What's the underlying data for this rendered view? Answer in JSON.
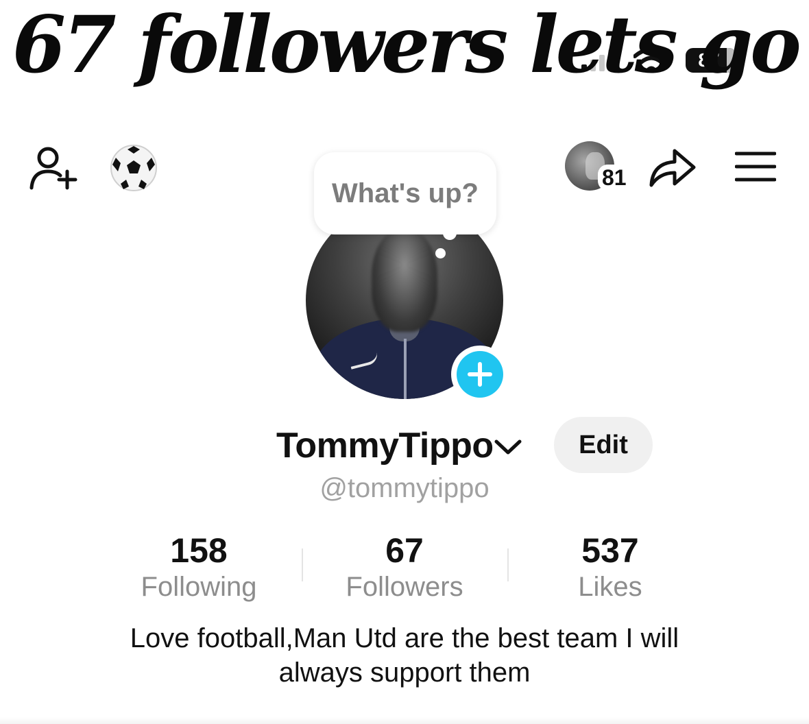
{
  "overlay_caption": "67 followers lets go",
  "status_bar": {
    "battery_level": "87",
    "signal_bars_active": 1,
    "signal_bars_total": 4
  },
  "top_nav": {
    "left_icons": [
      "add-friend-icon",
      "football-emoji-icon"
    ],
    "stories_count": "81",
    "right_icons": [
      "share-icon",
      "menu-icon"
    ]
  },
  "profile": {
    "status_prompt": "What's up?",
    "display_name": "TommyTippo",
    "username": "@tommytippo",
    "edit_label": "Edit",
    "add_story_icon": "plus-icon",
    "accent_color": "#20c5f0"
  },
  "stats": [
    {
      "value": "158",
      "label": "Following"
    },
    {
      "value": "67",
      "label": "Followers"
    },
    {
      "value": "537",
      "label": "Likes"
    }
  ],
  "bio": {
    "line1": "Love football,Man Utd are the best team I will",
    "line2": "always support them"
  }
}
